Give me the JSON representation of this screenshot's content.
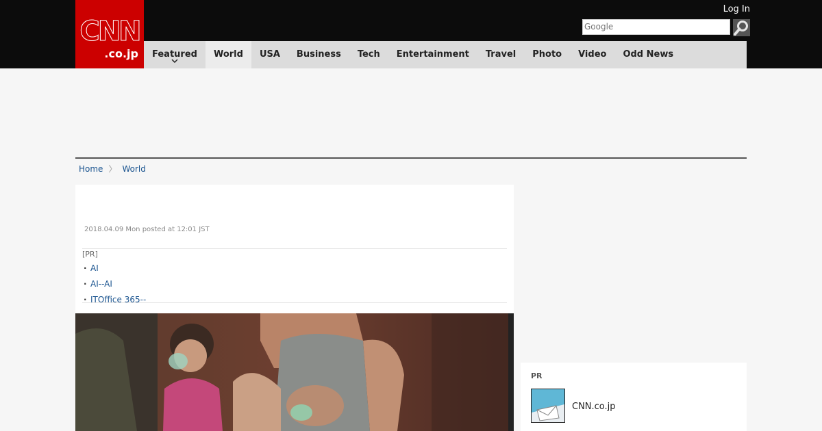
{
  "header": {
    "logo_main": "CNN",
    "logo_domain": ".co.jp",
    "login_label": "Log In",
    "search_placeholder": "Google"
  },
  "nav": {
    "items": [
      {
        "label": "Featured"
      },
      {
        "label": "World"
      },
      {
        "label": "USA"
      },
      {
        "label": "Business"
      },
      {
        "label": "Tech"
      },
      {
        "label": "Entertainment"
      },
      {
        "label": "Travel"
      },
      {
        "label": "Photo"
      },
      {
        "label": "Video"
      },
      {
        "label": "Odd News"
      }
    ]
  },
  "breadcrumb": {
    "home": "Home",
    "separator": "〉",
    "current": "World"
  },
  "article": {
    "date": "2018.04.09 Mon posted at 12:01 JST",
    "pr_tag": "[PR]",
    "pr_links": [
      "AI",
      "AI--AI",
      "ITOffice 365--"
    ]
  },
  "sidebar": {
    "pr_label": "PR",
    "item_text": "CNN.co.jp"
  },
  "colors": {
    "brand_red": "#cc0000",
    "link_blue": "#19538f",
    "topbar": "#0c0c0c"
  }
}
